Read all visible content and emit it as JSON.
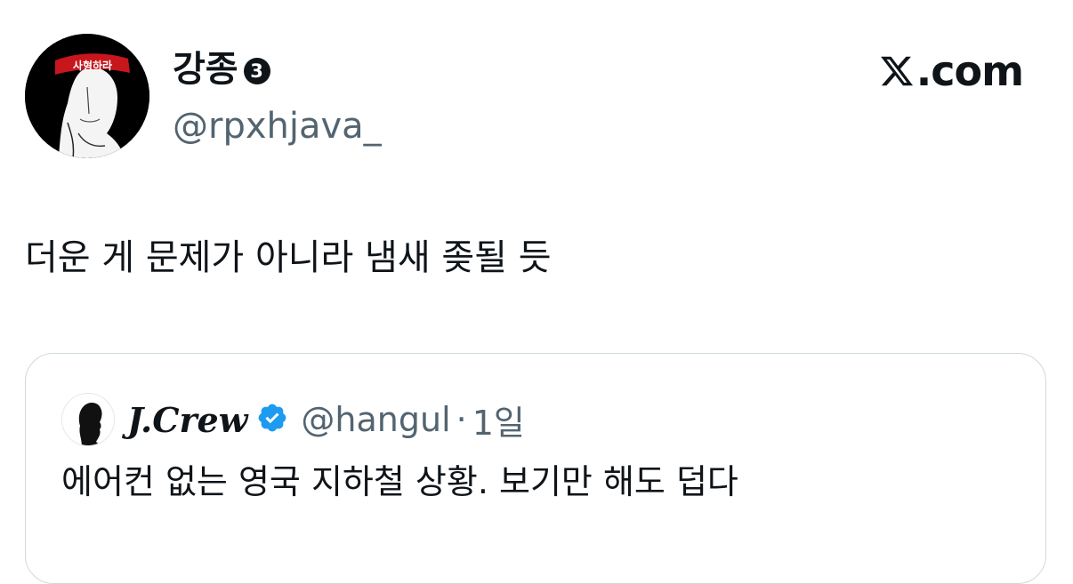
{
  "tweet": {
    "author": {
      "display_name": "강종",
      "badge_number": "3",
      "handle": "@rpxhjava_",
      "avatar_icon": "user-illustration-avatar-icon",
      "headband_text": "사형하라"
    },
    "brand": {
      "logo_icon": "x-logo-icon",
      "logo_suffix": ".com"
    },
    "text": "더운 게 문제가 아니라 냄새 좆될 듯"
  },
  "quoted_tweet": {
    "author": {
      "display_name": "J.Crew",
      "handle": "@hangul",
      "verified_icon": "verified-badge-icon",
      "avatar_icon": "silhouette-avatar-icon"
    },
    "separator": "·",
    "time": "1일",
    "text": "에어컨 없는 영국 지하철 상황. 보기만 해도 덥다"
  },
  "colors": {
    "text_primary": "#0f1419",
    "text_secondary": "#536471",
    "verified_blue": "#1d9bf0",
    "border": "#cfd9de"
  }
}
